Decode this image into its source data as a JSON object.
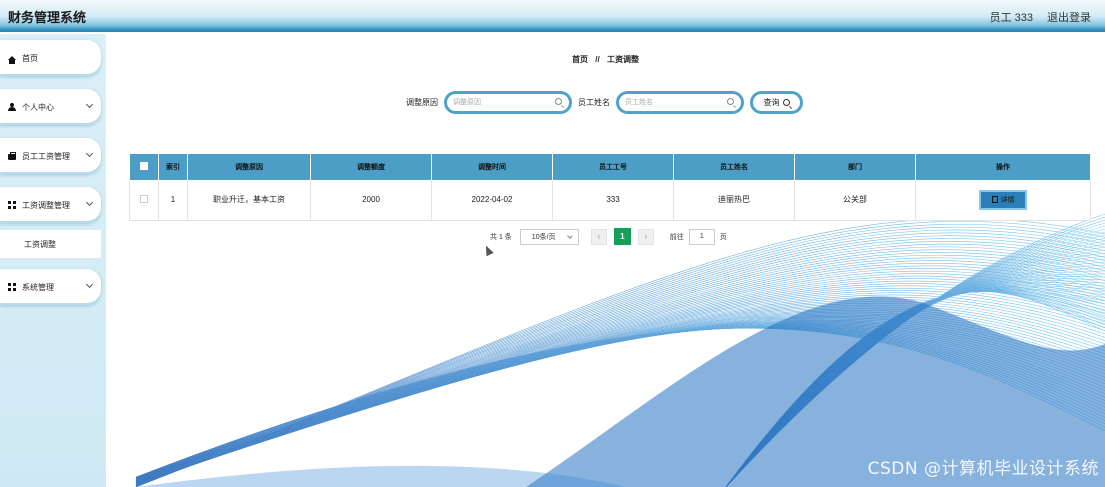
{
  "header": {
    "app_title": "财务管理系统",
    "user_label": "员工 333",
    "logout_label": "退出登录"
  },
  "sidebar": {
    "items": [
      {
        "label": "首页",
        "icon": "home-icon"
      },
      {
        "label": "个人中心",
        "icon": "user-icon"
      },
      {
        "label": "员工工资管理",
        "icon": "briefcase-icon"
      },
      {
        "label": "工资调整管理",
        "icon": "grid-icon"
      },
      {
        "label": "系统管理",
        "icon": "grid-icon"
      }
    ],
    "sub_item": "工资调整"
  },
  "breadcrumb": {
    "home": "首页",
    "separator": "//",
    "current": "工资调整"
  },
  "search": {
    "reason_label": "调整原因",
    "reason_placeholder": "调整原因",
    "name_label": "员工姓名",
    "name_placeholder": "员工姓名",
    "query_label": "查询"
  },
  "table": {
    "columns": [
      "索引",
      "调整原因",
      "调整额度",
      "调整时间",
      "员工工号",
      "员工姓名",
      "部门",
      "操作"
    ],
    "rows": [
      {
        "index": "1",
        "reason": "职业升迁，基本工资",
        "amount": "2000",
        "time": "2022-04-02",
        "emp_no": "333",
        "emp_name": "迪丽热巴",
        "dept": "公关部",
        "action": "详情"
      }
    ]
  },
  "pager": {
    "total": "共 1 条",
    "page_size": "10条/页",
    "prev": "‹",
    "current_page": "1",
    "next": "›",
    "goto_label": "前往",
    "goto_value": "1",
    "page_unit": "页"
  },
  "watermark": "CSDN @计算机毕业设计系统",
  "colors": {
    "accent": "#4c9ec6",
    "header_bar": "#2b89bb",
    "pager_active": "#14a05a",
    "detail_button": "#2a7fb8"
  }
}
